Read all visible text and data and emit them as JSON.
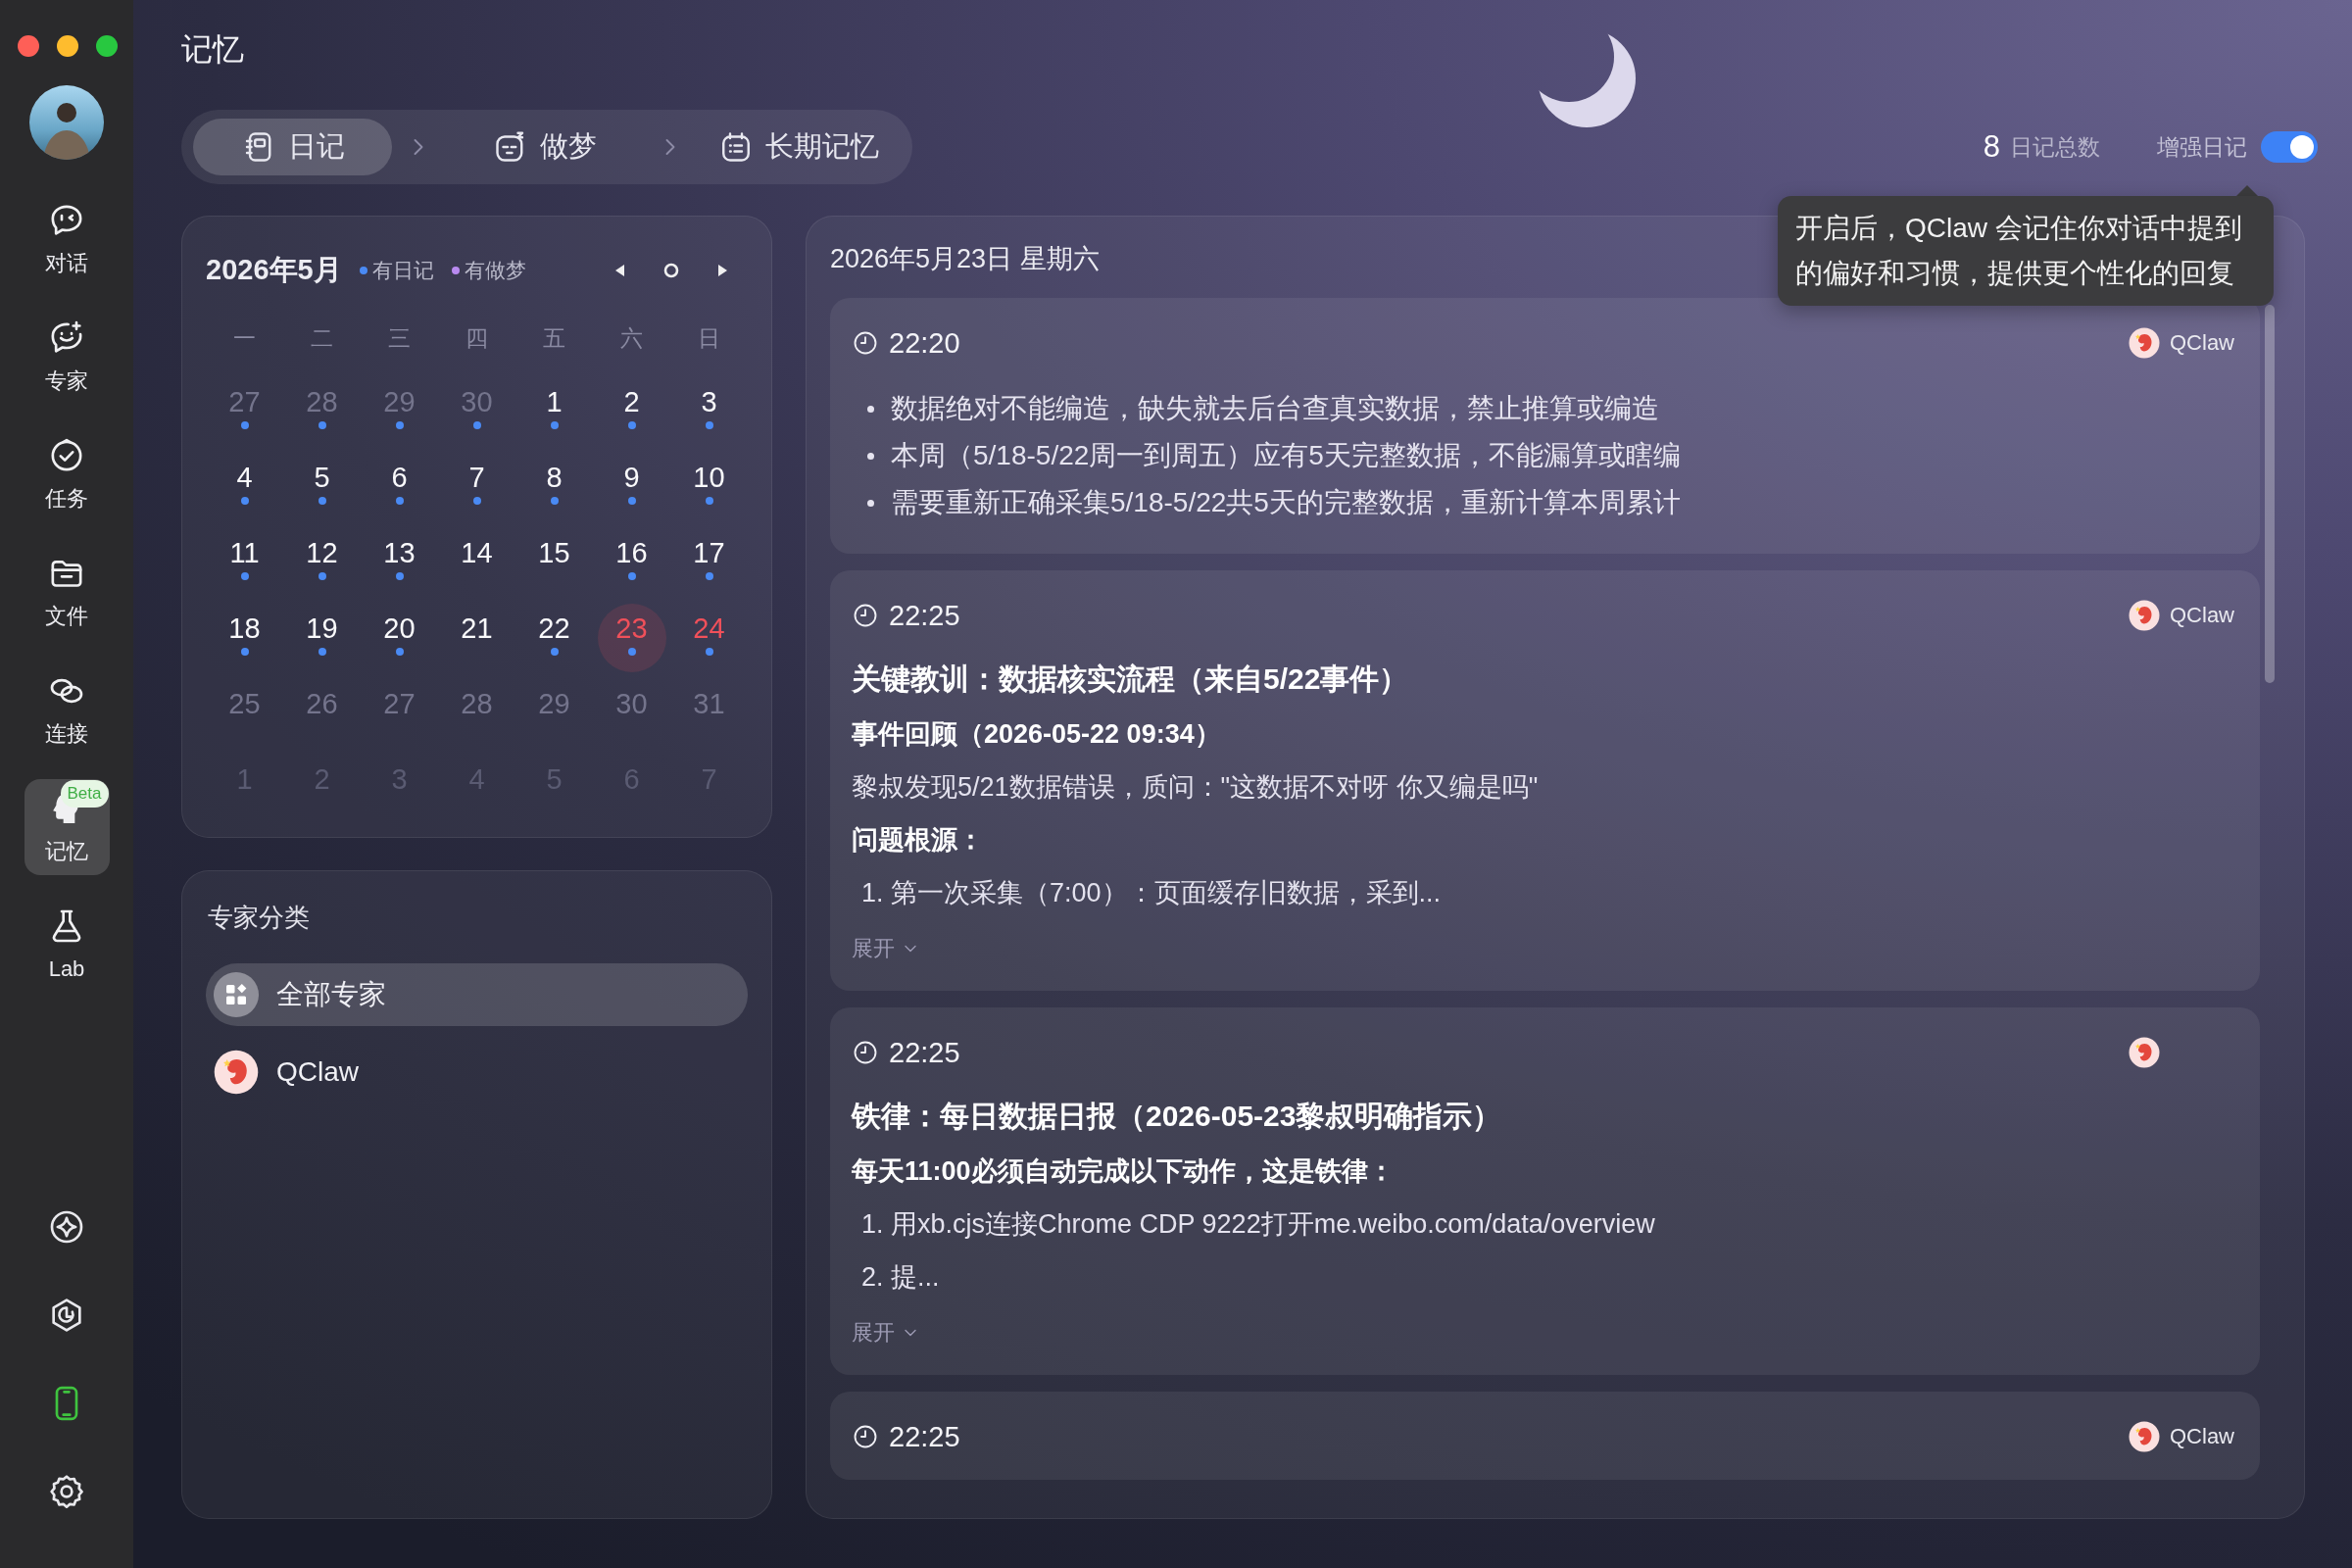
{
  "page_title": "记忆",
  "sidebar": {
    "items": [
      {
        "label": "对话",
        "selected": false
      },
      {
        "label": "专家",
        "selected": false
      },
      {
        "label": "任务",
        "selected": false
      },
      {
        "label": "文件",
        "selected": false
      },
      {
        "label": "连接",
        "selected": false
      },
      {
        "label": "记忆",
        "selected": true,
        "badge": "Beta"
      },
      {
        "label": "Lab",
        "selected": false
      }
    ]
  },
  "tabs": [
    {
      "label": "日记",
      "selected": true
    },
    {
      "label": "做梦",
      "selected": false
    },
    {
      "label": "长期记忆",
      "selected": false
    }
  ],
  "stats": {
    "count": "8",
    "count_label": "日记总数"
  },
  "enhance": {
    "label": "增强日记",
    "on": true,
    "tooltip": "开启后，QClaw 会记住你对话中提到的偏好和习惯，提供更个性化的回复"
  },
  "calendar": {
    "title": "2026年5月",
    "legend": [
      {
        "label": "有日记",
        "color": "#4a8af4"
      },
      {
        "label": "有做梦",
        "color": "#b98af0"
      }
    ],
    "weekdays": [
      "一",
      "二",
      "三",
      "四",
      "五",
      "六",
      "日"
    ],
    "days": [
      {
        "day": "27",
        "kind": "muted",
        "diary": true,
        "selected": false,
        "today": false
      },
      {
        "day": "28",
        "kind": "muted",
        "diary": true,
        "selected": false,
        "today": false
      },
      {
        "day": "29",
        "kind": "muted",
        "diary": true,
        "selected": false,
        "today": false
      },
      {
        "day": "30",
        "kind": "muted",
        "diary": true,
        "selected": false,
        "today": false
      },
      {
        "day": "1",
        "kind": "current",
        "diary": true,
        "selected": false,
        "today": false
      },
      {
        "day": "2",
        "kind": "current",
        "diary": true,
        "selected": false,
        "today": false
      },
      {
        "day": "3",
        "kind": "current",
        "diary": true,
        "selected": false,
        "today": false
      },
      {
        "day": "4",
        "kind": "current",
        "diary": true,
        "selected": false,
        "today": false
      },
      {
        "day": "5",
        "kind": "current",
        "diary": true,
        "selected": false,
        "today": false
      },
      {
        "day": "6",
        "kind": "current",
        "diary": true,
        "selected": false,
        "today": false
      },
      {
        "day": "7",
        "kind": "current",
        "diary": true,
        "selected": false,
        "today": false
      },
      {
        "day": "8",
        "kind": "current",
        "diary": true,
        "selected": false,
        "today": false
      },
      {
        "day": "9",
        "kind": "current",
        "diary": true,
        "selected": false,
        "today": false
      },
      {
        "day": "10",
        "kind": "current",
        "diary": true,
        "selected": false,
        "today": false
      },
      {
        "day": "11",
        "kind": "current",
        "diary": true,
        "selected": false,
        "today": false
      },
      {
        "day": "12",
        "kind": "current",
        "diary": true,
        "selected": false,
        "today": false
      },
      {
        "day": "13",
        "kind": "current",
        "diary": true,
        "selected": false,
        "today": false
      },
      {
        "day": "14",
        "kind": "current",
        "diary": false,
        "selected": false,
        "today": false
      },
      {
        "day": "15",
        "kind": "current",
        "diary": false,
        "selected": false,
        "today": false
      },
      {
        "day": "16",
        "kind": "current",
        "diary": true,
        "selected": false,
        "today": false
      },
      {
        "day": "17",
        "kind": "current",
        "diary": true,
        "selected": false,
        "today": false
      },
      {
        "day": "18",
        "kind": "current",
        "diary": true,
        "selected": false,
        "today": false
      },
      {
        "day": "19",
        "kind": "current",
        "diary": true,
        "selected": false,
        "today": false
      },
      {
        "day": "20",
        "kind": "current",
        "diary": true,
        "selected": false,
        "today": false
      },
      {
        "day": "21",
        "kind": "current",
        "diary": false,
        "selected": false,
        "today": false
      },
      {
        "day": "22",
        "kind": "current",
        "diary": true,
        "selected": false,
        "today": false
      },
      {
        "day": "23",
        "kind": "current",
        "diary": true,
        "selected": true,
        "today": false
      },
      {
        "day": "24",
        "kind": "current",
        "diary": true,
        "selected": false,
        "today": true
      },
      {
        "day": "25",
        "kind": "muted",
        "diary": false,
        "selected": false,
        "today": false
      },
      {
        "day": "26",
        "kind": "muted",
        "diary": false,
        "selected": false,
        "today": false
      },
      {
        "day": "27",
        "kind": "muted",
        "diary": false,
        "selected": false,
        "today": false
      },
      {
        "day": "28",
        "kind": "muted",
        "diary": false,
        "selected": false,
        "today": false
      },
      {
        "day": "29",
        "kind": "muted",
        "diary": false,
        "selected": false,
        "today": false
      },
      {
        "day": "30",
        "kind": "muted",
        "diary": false,
        "selected": false,
        "today": false
      },
      {
        "day": "31",
        "kind": "muted",
        "diary": false,
        "selected": false,
        "today": false
      },
      {
        "day": "1",
        "kind": "faint",
        "diary": false,
        "selected": false,
        "today": false
      },
      {
        "day": "2",
        "kind": "faint",
        "diary": false,
        "selected": false,
        "today": false
      },
      {
        "day": "3",
        "kind": "faint",
        "diary": false,
        "selected": false,
        "today": false
      },
      {
        "day": "4",
        "kind": "faint",
        "diary": false,
        "selected": false,
        "today": false
      },
      {
        "day": "5",
        "kind": "faint",
        "diary": false,
        "selected": false,
        "today": false
      },
      {
        "day": "6",
        "kind": "faint",
        "diary": false,
        "selected": false,
        "today": false
      },
      {
        "day": "7",
        "kind": "faint",
        "diary": false,
        "selected": false,
        "today": false
      }
    ]
  },
  "experts": {
    "title": "专家分类",
    "items": [
      {
        "label": "全部专家",
        "kind": "all",
        "selected": true
      },
      {
        "label": "QClaw",
        "kind": "agent",
        "selected": false
      }
    ]
  },
  "diary": {
    "date": "2026年5月23日 星期六",
    "entries": [
      {
        "time": "22:20",
        "author": "QClaw",
        "blocks": [
          {
            "kind": "bullet",
            "text": "数据绝对不能编造，缺失就去后台查真实数据，禁止推算或编造"
          },
          {
            "kind": "bullet",
            "text": "本周（5/18-5/22周一到周五）应有5天完整数据，不能漏算或瞎编"
          },
          {
            "kind": "bullet",
            "text": "需要重新正确采集5/18-5/22共5天的完整数据，重新计算本周累计"
          }
        ]
      },
      {
        "time": "22:25",
        "author": "QClaw",
        "blocks": [
          {
            "kind": "heading",
            "text": "关键教训：数据核实流程（来自5/22事件）"
          },
          {
            "kind": "bold",
            "text": "事件回顾（2026-05-22 09:34）"
          },
          {
            "kind": "text",
            "text": "黎叔发现5/21数据错误，质问：\"这数据不对呀 你又编是吗\""
          },
          {
            "kind": "bold",
            "text": "问题根源："
          },
          {
            "kind": "numbered",
            "text": "1. 第一次采集（7:00）：页面缓存旧数据，采到..."
          }
        ],
        "expand": "展开"
      },
      {
        "time": "22:25",
        "blocks": [
          {
            "kind": "heading",
            "text": "铁律：每日数据日报（2026-05-23黎叔明确指示）"
          },
          {
            "kind": "bold",
            "text": "每天11:00必须自动完成以下动作，这是铁律："
          },
          {
            "kind": "numbered",
            "text": "1. 用xb.cjs连接Chrome CDP 9222打开me.weibo.com/data/overview"
          },
          {
            "kind": "numbered",
            "text": "2. 提..."
          }
        ],
        "expand": "展开"
      },
      {
        "time": "22:25",
        "author": "QClaw"
      }
    ]
  }
}
